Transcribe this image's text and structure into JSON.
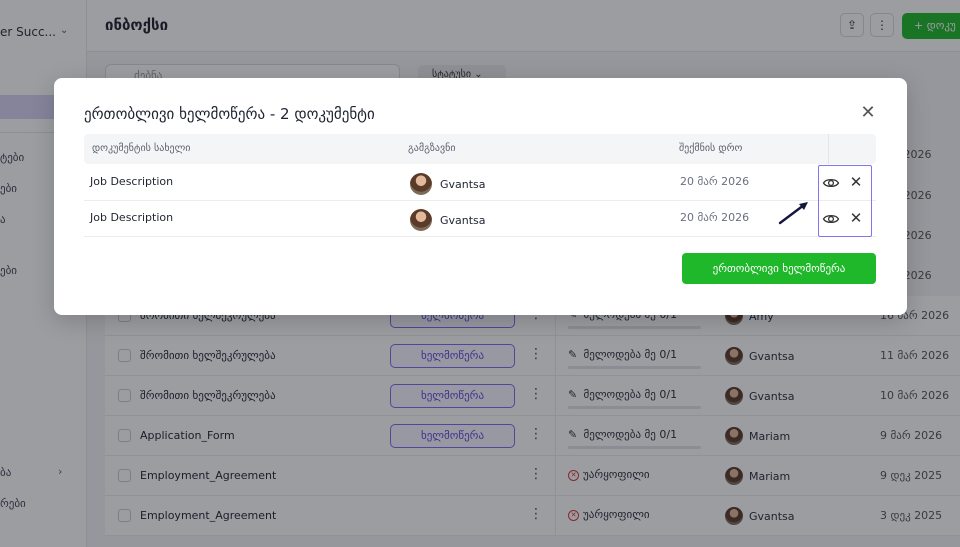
{
  "sidebar": {
    "workspace": "er Succ...",
    "items": [
      {
        "label": "ტები"
      },
      {
        "label": "ები"
      },
      {
        "label": "ა"
      },
      {
        "label": "ები"
      },
      {
        "label": "ბა"
      },
      {
        "label": "რები"
      }
    ]
  },
  "header": {
    "title": "ინბოქსი",
    "new_button": "+  დოკუ"
  },
  "toolbar": {
    "search_placeholder": "ძებნა",
    "filter_label": "სტატუსი"
  },
  "background_dates": [
    "შარ 2026",
    "მარ 2026",
    "მარ 2026",
    "მარ 2026"
  ],
  "table_rows": [
    {
      "name": "შრომითი ხელშეკრულება",
      "action": "ხელმოწერა",
      "status": "მელოდება მე 0/1",
      "assignee": "Amy",
      "date": "16 მარ 2026"
    },
    {
      "name": "შრომითი ხელშეკრულება",
      "action": "ხელმოწერა",
      "status": "მელოდება მე 0/1",
      "assignee": "Gvantsa",
      "date": "11 მარ 2026"
    },
    {
      "name": "შრომითი ხელშეკრულება",
      "action": "ხელმოწერა",
      "status": "მელოდება მე 0/1",
      "assignee": "Gvantsa",
      "date": "10 მარ 2026"
    },
    {
      "name": "Application_Form",
      "action": "ხელმოწერა",
      "status": "მელოდება მე 0/1",
      "assignee": "Mariam",
      "date": "9 მარ 2026"
    },
    {
      "name": "Employment_Agreement",
      "action": "",
      "status": "უარყოფილი",
      "assignee": "Mariam",
      "date": "9 დეკ 2025"
    },
    {
      "name": "Employment_Agreement",
      "action": "",
      "status": "უარყოფილი",
      "assignee": "Gvantsa",
      "date": "3 დეკ 2025"
    }
  ],
  "modal": {
    "title": "ერთობლივი ხელმოწერა - 2 დოკუმენტი",
    "columns": {
      "document": "დოკუმენტის სახელი",
      "sender": "გამგზავნი",
      "created": "შექმნის დრო"
    },
    "rows": [
      {
        "document": "Job Description",
        "sender": "Gvantsa",
        "created": "20 მარ 2026"
      },
      {
        "document": "Job Description",
        "sender": "Gvantsa",
        "created": "20 მარ 2026"
      }
    ],
    "primary_button": "ერთობლივი ხელმოწერა"
  },
  "colors": {
    "accent_green": "#1fb82a",
    "accent_purple": "#7b6cf0",
    "danger_red": "#d9363e"
  },
  "icons": [
    "search-icon",
    "chevron-down-icon",
    "upload-icon",
    "more-icon",
    "pen-icon",
    "rejected-icon",
    "eye-icon",
    "close-icon",
    "arrow-pointer-icon"
  ]
}
